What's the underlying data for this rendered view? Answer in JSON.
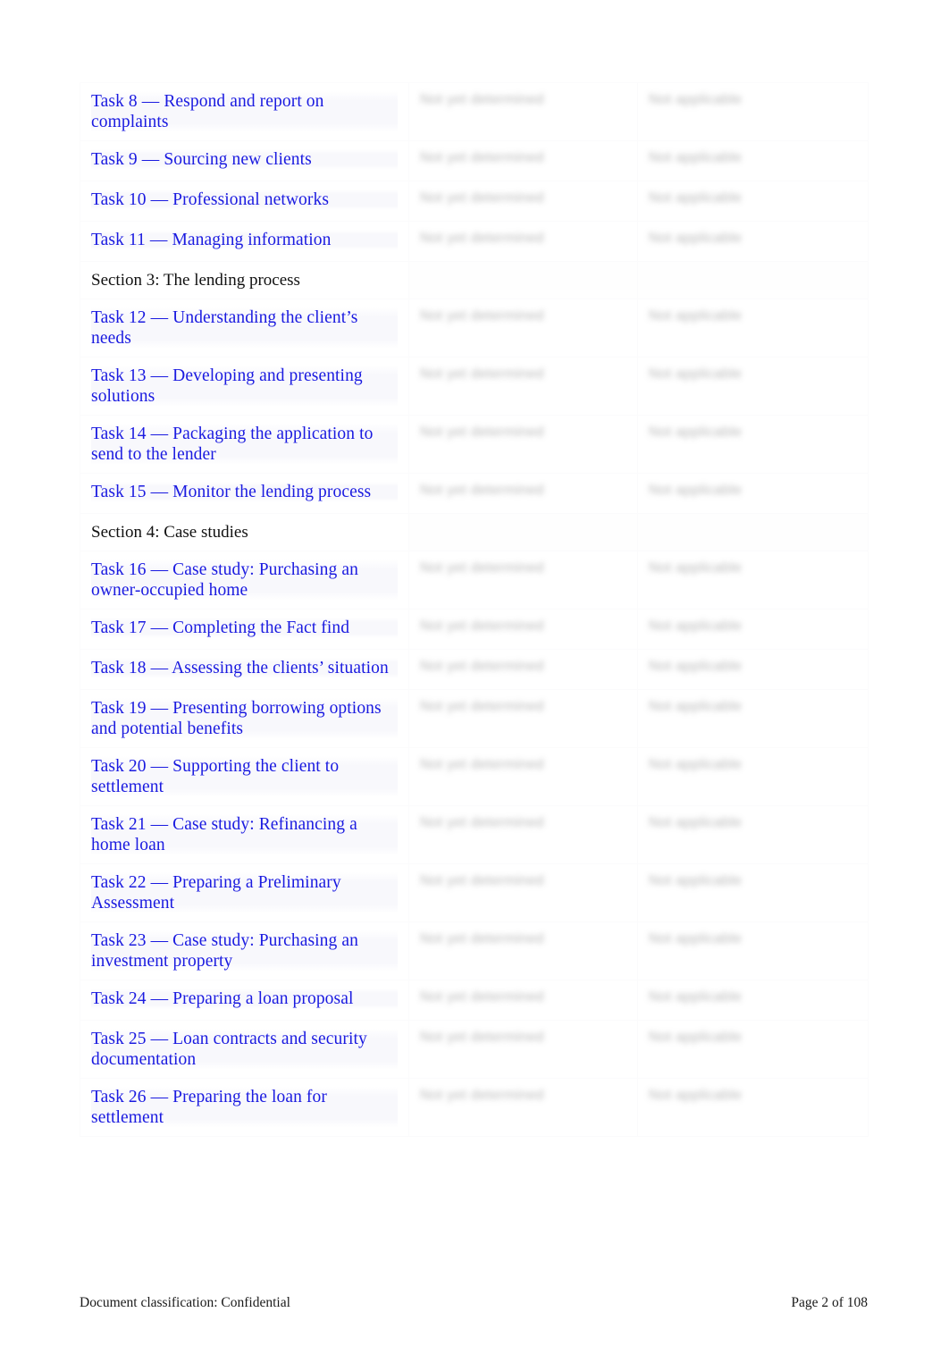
{
  "document": {
    "page_background": "#ffffff",
    "link_color": "#1a1ae0",
    "text_color": "#111111"
  },
  "toc": {
    "rows": [
      {
        "type": "task",
        "title": "Task 8 — Respond and report on complaints",
        "middle": "Not yet determined",
        "right": "Not applicable"
      },
      {
        "type": "task",
        "title": "Task 9 — Sourcing new clients",
        "middle": "Not yet determined",
        "right": "Not applicable"
      },
      {
        "type": "task",
        "title": "Task 10 — Professional networks",
        "middle": "Not yet determined",
        "right": "Not applicable"
      },
      {
        "type": "task",
        "title": "Task 11 — Managing information",
        "middle": "Not yet determined",
        "right": "Not applicable"
      },
      {
        "type": "section",
        "title": "Section 3: The lending process",
        "middle": "",
        "right": ""
      },
      {
        "type": "task",
        "title": "Task 12 — Understanding the client’s needs",
        "middle": "Not yet determined",
        "right": "Not applicable"
      },
      {
        "type": "task",
        "title": "Task 13 — Developing and presenting solutions",
        "middle": "Not yet determined",
        "right": "Not applicable"
      },
      {
        "type": "task",
        "title": "Task 14 — Packaging the application to send to the lender",
        "middle": "Not yet determined",
        "right": "Not applicable"
      },
      {
        "type": "task",
        "title": "Task 15 — Monitor the lending process",
        "middle": "Not yet determined",
        "right": "Not applicable"
      },
      {
        "type": "section",
        "title": "Section 4: Case studies",
        "middle": "",
        "right": ""
      },
      {
        "type": "task",
        "title": "Task 16 — Case study: Purchasing an owner-occupied home",
        "middle": "Not yet determined",
        "right": "Not applicable"
      },
      {
        "type": "task",
        "title": "Task 17 — Completing the Fact find",
        "middle": "Not yet determined",
        "right": "Not applicable"
      },
      {
        "type": "task",
        "title": "Task 18 — Assessing the clients’ situation",
        "middle": "Not yet determined",
        "right": "Not applicable"
      },
      {
        "type": "task",
        "title": "Task 19 — Presenting borrowing options and potential benefits",
        "middle": "Not yet determined",
        "right": "Not applicable"
      },
      {
        "type": "task",
        "title": "Task 20 — Supporting the client to settlement",
        "middle": "Not yet determined",
        "right": "Not applicable"
      },
      {
        "type": "task",
        "title": "Task 21 — Case study: Refinancing a home loan",
        "middle": "Not yet determined",
        "right": "Not applicable"
      },
      {
        "type": "task",
        "title": "Task 22 — Preparing a Preliminary Assessment",
        "middle": "Not yet determined",
        "right": "Not applicable"
      },
      {
        "type": "task",
        "title": "Task 23 — Case study: Purchasing an investment property",
        "middle": "Not yet determined",
        "right": "Not applicable"
      },
      {
        "type": "task",
        "title": "Task 24 — Preparing a loan proposal",
        "middle": "Not yet determined",
        "right": "Not applicable"
      },
      {
        "type": "task",
        "title": "Task 25 — Loan contracts and security documentation",
        "middle": "Not yet determined",
        "right": "Not applicable"
      },
      {
        "type": "task",
        "title": "Task 26 — Preparing the loan for settlement",
        "middle": "Not yet determined",
        "right": "Not applicable"
      }
    ]
  },
  "footer": {
    "classification": "Document classification: Confidential",
    "page_number": "Page 2 of 108"
  }
}
